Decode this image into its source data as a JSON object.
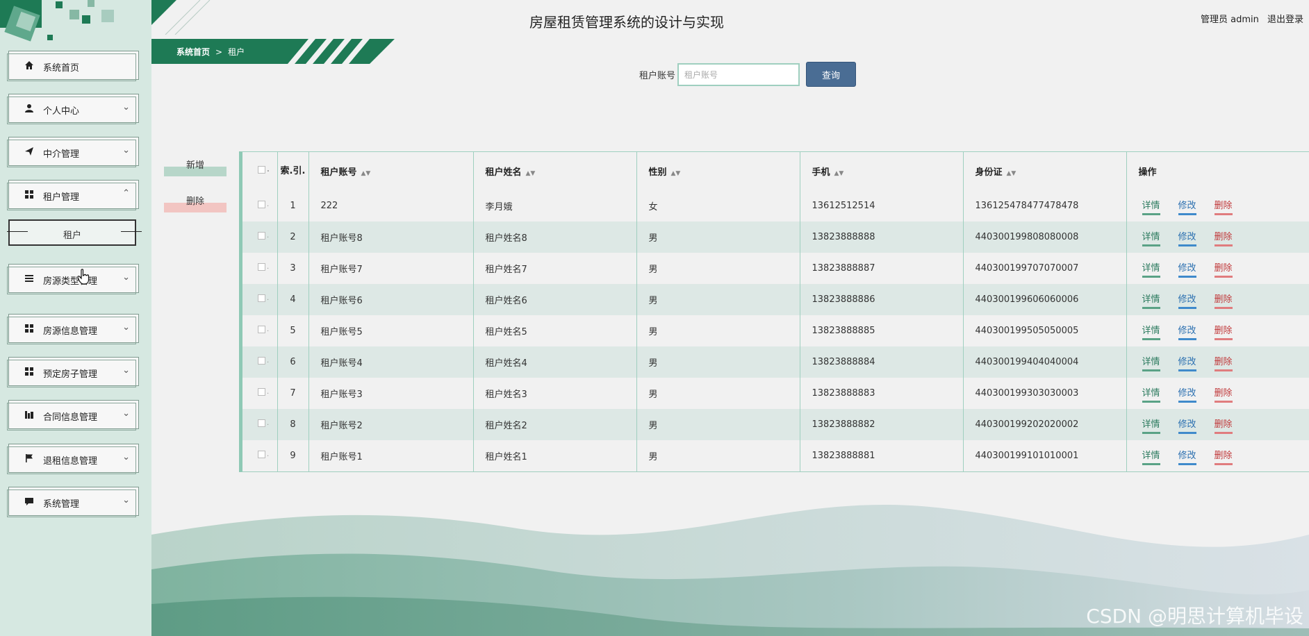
{
  "header": {
    "title": "房屋租赁管理系统的设计与实现",
    "user_label": "管理员 admin",
    "logout_label": "退出登录"
  },
  "breadcrumb": {
    "home": "系统首页",
    "separator": ">",
    "current": "租户"
  },
  "search": {
    "label": "租户账号",
    "placeholder": "租户账号",
    "button_label": "查询"
  },
  "actions": {
    "add_label": "新增",
    "delete_label": "删除"
  },
  "sidebar": {
    "items": [
      {
        "label": "系统首页",
        "icon": "home-icon",
        "chevron": ""
      },
      {
        "label": "个人中心",
        "icon": "user-icon",
        "chevron": "⌄"
      },
      {
        "label": "中介管理",
        "icon": "send-icon",
        "chevron": "⌄"
      },
      {
        "label": "租户管理",
        "icon": "grid-icon",
        "chevron": "⌃"
      },
      {
        "label": "房源类型管理",
        "icon": "list-icon",
        "chevron": "⌄"
      },
      {
        "label": "房源信息管理",
        "icon": "grid-icon",
        "chevron": "⌄"
      },
      {
        "label": "预定房子管理",
        "icon": "grid-icon",
        "chevron": "⌄"
      },
      {
        "label": "合同信息管理",
        "icon": "bar-icon",
        "chevron": "⌄"
      },
      {
        "label": "退租信息管理",
        "icon": "flag-icon",
        "chevron": "⌄"
      },
      {
        "label": "系统管理",
        "icon": "chat-icon",
        "chevron": "⌄"
      }
    ],
    "sub_item": "租户"
  },
  "table": {
    "columns": {
      "index": "索.引.",
      "account": "租户账号",
      "name": "租户姓名",
      "gender": "性别",
      "phone": "手机",
      "idcard": "身份证",
      "ops": "操作"
    },
    "op_labels": {
      "detail": "详情",
      "edit": "修改",
      "delete": "删除"
    },
    "rows": [
      {
        "index": "1",
        "account": "222",
        "name": "李月娥",
        "gender": "女",
        "phone": "13612512514",
        "idcard": "136125478477478478"
      },
      {
        "index": "2",
        "account": "租户账号8",
        "name": "租户姓名8",
        "gender": "男",
        "phone": "13823888888",
        "idcard": "440300199808080008"
      },
      {
        "index": "3",
        "account": "租户账号7",
        "name": "租户姓名7",
        "gender": "男",
        "phone": "13823888887",
        "idcard": "440300199707070007"
      },
      {
        "index": "4",
        "account": "租户账号6",
        "name": "租户姓名6",
        "gender": "男",
        "phone": "13823888886",
        "idcard": "440300199606060006"
      },
      {
        "index": "5",
        "account": "租户账号5",
        "name": "租户姓名5",
        "gender": "男",
        "phone": "13823888885",
        "idcard": "440300199505050005"
      },
      {
        "index": "6",
        "account": "租户账号4",
        "name": "租户姓名4",
        "gender": "男",
        "phone": "13823888884",
        "idcard": "440300199404040004"
      },
      {
        "index": "7",
        "account": "租户账号3",
        "name": "租户姓名3",
        "gender": "男",
        "phone": "13823888883",
        "idcard": "440300199303030003"
      },
      {
        "index": "8",
        "account": "租户账号2",
        "name": "租户姓名2",
        "gender": "男",
        "phone": "13823888882",
        "idcard": "440300199202020002"
      },
      {
        "index": "9",
        "account": "租户账号1",
        "name": "租户姓名1",
        "gender": "男",
        "phone": "13823888881",
        "idcard": "440300199101010001"
      }
    ]
  },
  "watermark": "CSDN @明思计算机毕设",
  "colors": {
    "brand_green": "#1e7a55",
    "sidebar_bg": "#d6e8e1",
    "row_alt": "#dde8e5",
    "search_btn": "#4a6d94"
  }
}
